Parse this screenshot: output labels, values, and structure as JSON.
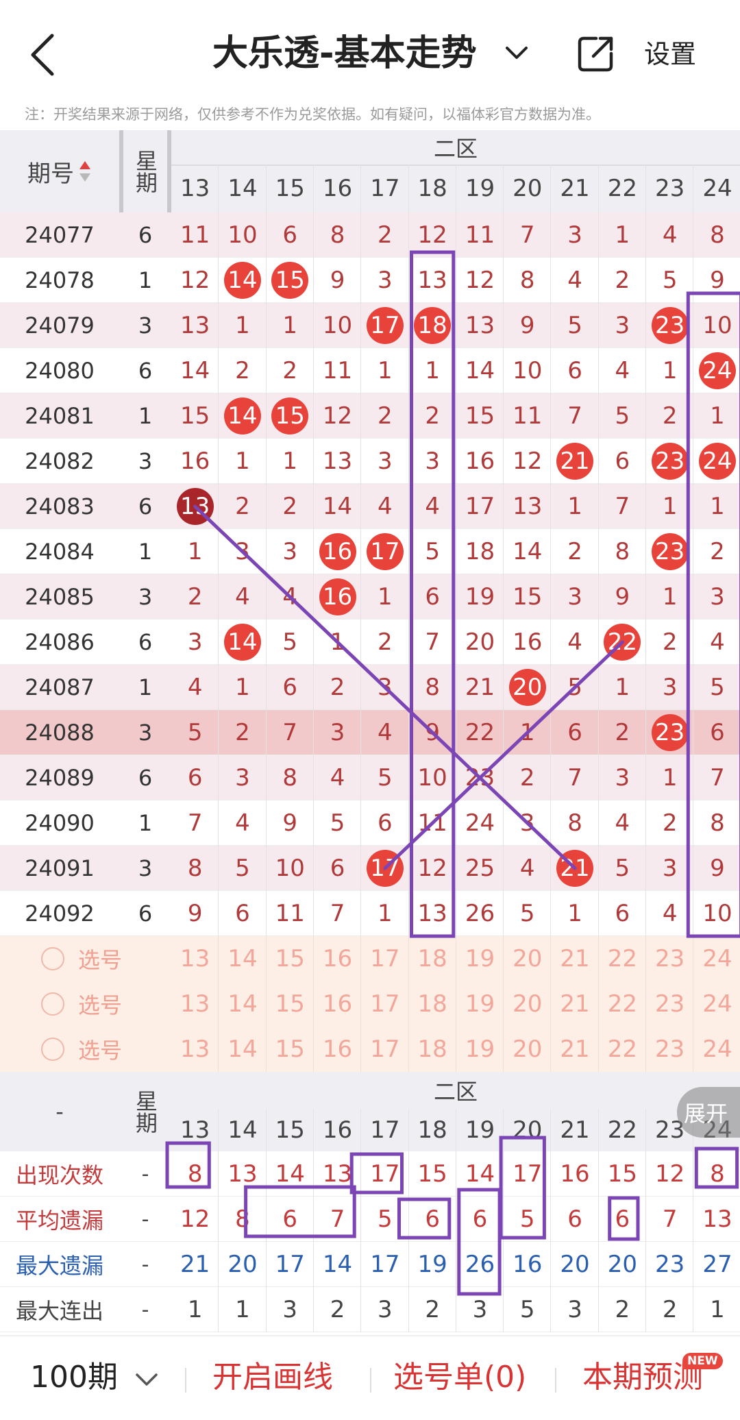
{
  "header": {
    "title": "大乐透-基本走势",
    "settings_label": "设置",
    "note": "注：开奖结果来源于网络，仅供参考不作为兑奖依据。如有疑问，以福体彩官方数据为准。"
  },
  "table": {
    "col_issue_label": "期号",
    "col_week_label": "星期",
    "zone_label": "二区",
    "numbers": [
      "13",
      "14",
      "15",
      "16",
      "17",
      "18",
      "19",
      "20",
      "21",
      "22",
      "23",
      "24"
    ],
    "rows": [
      {
        "issue": "24077",
        "week": "6",
        "cells": [
          "11",
          "10",
          "6",
          "8",
          "2",
          "12",
          "11",
          "7",
          "3",
          "1",
          "4",
          "8"
        ],
        "hits": []
      },
      {
        "issue": "24078",
        "week": "1",
        "cells": [
          "12",
          "14",
          "15",
          "9",
          "3",
          "13",
          "12",
          "8",
          "4",
          "2",
          "5",
          "9"
        ],
        "hits": [
          1,
          2
        ]
      },
      {
        "issue": "24079",
        "week": "3",
        "cells": [
          "13",
          "1",
          "1",
          "10",
          "17",
          "18",
          "13",
          "9",
          "5",
          "3",
          "23",
          "10"
        ],
        "hits": [
          4,
          5,
          10
        ]
      },
      {
        "issue": "24080",
        "week": "6",
        "cells": [
          "14",
          "2",
          "2",
          "11",
          "1",
          "1",
          "14",
          "10",
          "6",
          "4",
          "1",
          "24"
        ],
        "hits": [
          11
        ]
      },
      {
        "issue": "24081",
        "week": "1",
        "cells": [
          "15",
          "14",
          "15",
          "12",
          "2",
          "2",
          "15",
          "11",
          "7",
          "5",
          "2",
          "1"
        ],
        "hits": [
          1,
          2
        ]
      },
      {
        "issue": "24082",
        "week": "3",
        "cells": [
          "16",
          "1",
          "1",
          "13",
          "3",
          "3",
          "16",
          "12",
          "21",
          "6",
          "23",
          "24"
        ],
        "hits": [
          8,
          10,
          11
        ]
      },
      {
        "issue": "24083",
        "week": "6",
        "cells": [
          "13",
          "2",
          "2",
          "14",
          "4",
          "4",
          "17",
          "13",
          "1",
          "7",
          "1",
          "1"
        ],
        "hits": [
          0
        ],
        "dark_hits": [
          0
        ]
      },
      {
        "issue": "24084",
        "week": "1",
        "cells": [
          "1",
          "3",
          "3",
          "16",
          "17",
          "5",
          "18",
          "14",
          "2",
          "8",
          "23",
          "2"
        ],
        "hits": [
          3,
          4,
          10
        ]
      },
      {
        "issue": "24085",
        "week": "3",
        "cells": [
          "2",
          "4",
          "4",
          "16",
          "1",
          "6",
          "19",
          "15",
          "3",
          "9",
          "1",
          "3"
        ],
        "hits": [
          3
        ]
      },
      {
        "issue": "24086",
        "week": "6",
        "cells": [
          "3",
          "14",
          "5",
          "1",
          "2",
          "7",
          "20",
          "16",
          "4",
          "22",
          "2",
          "4"
        ],
        "hits": [
          1,
          9
        ]
      },
      {
        "issue": "24087",
        "week": "1",
        "cells": [
          "4",
          "1",
          "6",
          "2",
          "3",
          "8",
          "21",
          "20",
          "5",
          "1",
          "3",
          "5"
        ],
        "hits": [
          7
        ]
      },
      {
        "issue": "24088",
        "week": "3",
        "cells": [
          "5",
          "2",
          "7",
          "3",
          "4",
          "9",
          "22",
          "1",
          "6",
          "2",
          "23",
          "6"
        ],
        "hits": [
          10
        ]
      },
      {
        "issue": "24089",
        "week": "6",
        "cells": [
          "6",
          "3",
          "8",
          "4",
          "5",
          "10",
          "23",
          "2",
          "7",
          "3",
          "1",
          "7"
        ],
        "hits": []
      },
      {
        "issue": "24090",
        "week": "1",
        "cells": [
          "7",
          "4",
          "9",
          "5",
          "6",
          "11",
          "24",
          "3",
          "8",
          "4",
          "2",
          "8"
        ],
        "hits": []
      },
      {
        "issue": "24091",
        "week": "3",
        "cells": [
          "8",
          "5",
          "10",
          "6",
          "17",
          "12",
          "25",
          "4",
          "21",
          "5",
          "3",
          "9"
        ],
        "hits": [
          4,
          8
        ]
      },
      {
        "issue": "24092",
        "week": "6",
        "cells": [
          "9",
          "6",
          "11",
          "7",
          "1",
          "13",
          "26",
          "5",
          "1",
          "6",
          "4",
          "10"
        ],
        "hits": []
      }
    ],
    "pick_label": "选号",
    "pick_rows": 3,
    "stats": [
      {
        "label": "出现次数",
        "dash": "-",
        "values": [
          "8",
          "13",
          "14",
          "13",
          "17",
          "15",
          "14",
          "17",
          "16",
          "15",
          "12",
          "8"
        ],
        "color": "#c43a3a"
      },
      {
        "label": "平均遗漏",
        "dash": "-",
        "values": [
          "12",
          "8",
          "6",
          "7",
          "5",
          "6",
          "6",
          "5",
          "6",
          "6",
          "7",
          "13"
        ],
        "color": "#c43a3a"
      },
      {
        "label": "最大遗漏",
        "dash": "-",
        "values": [
          "21",
          "20",
          "17",
          "14",
          "17",
          "19",
          "26",
          "16",
          "20",
          "20",
          "23",
          "27"
        ],
        "color": "#2a5fb0"
      },
      {
        "label": "最大连出",
        "dash": "-",
        "values": [
          "1",
          "1",
          "3",
          "2",
          "3",
          "2",
          "3",
          "5",
          "3",
          "2",
          "2",
          "1"
        ],
        "color": "#444444"
      }
    ],
    "stats_corner": "-",
    "expand_label": "展开"
  },
  "bottom_bar": {
    "period": "100期",
    "draw_line": "开启画线",
    "picks": "选号单(0)",
    "predict": "本期预测",
    "new_badge": "NEW"
  },
  "colors": {
    "ball_red": "#e8433a",
    "ball_dark": "#a8262a",
    "miss_text": "#b03a3a",
    "annotation": "#7b45b5"
  }
}
